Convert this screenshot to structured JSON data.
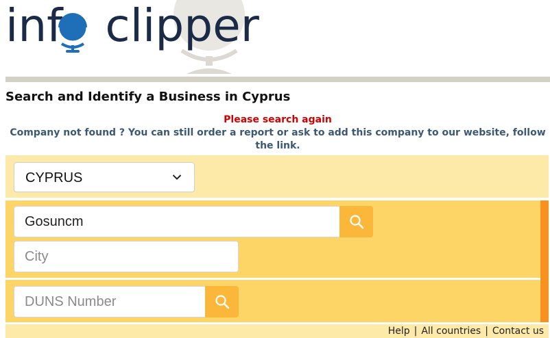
{
  "logo": {
    "text_before": "inf",
    "text_after": "clipper"
  },
  "page": {
    "title": "Search and Identify a Business in Cyprus",
    "error_message": "Please search again",
    "info_message": "Company not found ? You can still order a report or ask to add this company to our website, follow the link."
  },
  "country_select": {
    "value": "CYPRUS"
  },
  "search": {
    "name_value": "Gosuncm",
    "city_placeholder": "City",
    "duns_placeholder": "DUNS Number"
  },
  "footer": {
    "help": "Help",
    "all_countries": "All countries",
    "contact": "Contact us",
    "separator": "|"
  },
  "colors": {
    "logo_navy": "#1b2a47",
    "logo_blue": "#1e6fb7",
    "error_red": "#d40000",
    "info_blue": "#3b5874",
    "panel_light": "#fde9a8",
    "panel_yellow": "#fdd466",
    "button_yellow": "#fbb73a",
    "strip_orange": "#f7921e"
  }
}
